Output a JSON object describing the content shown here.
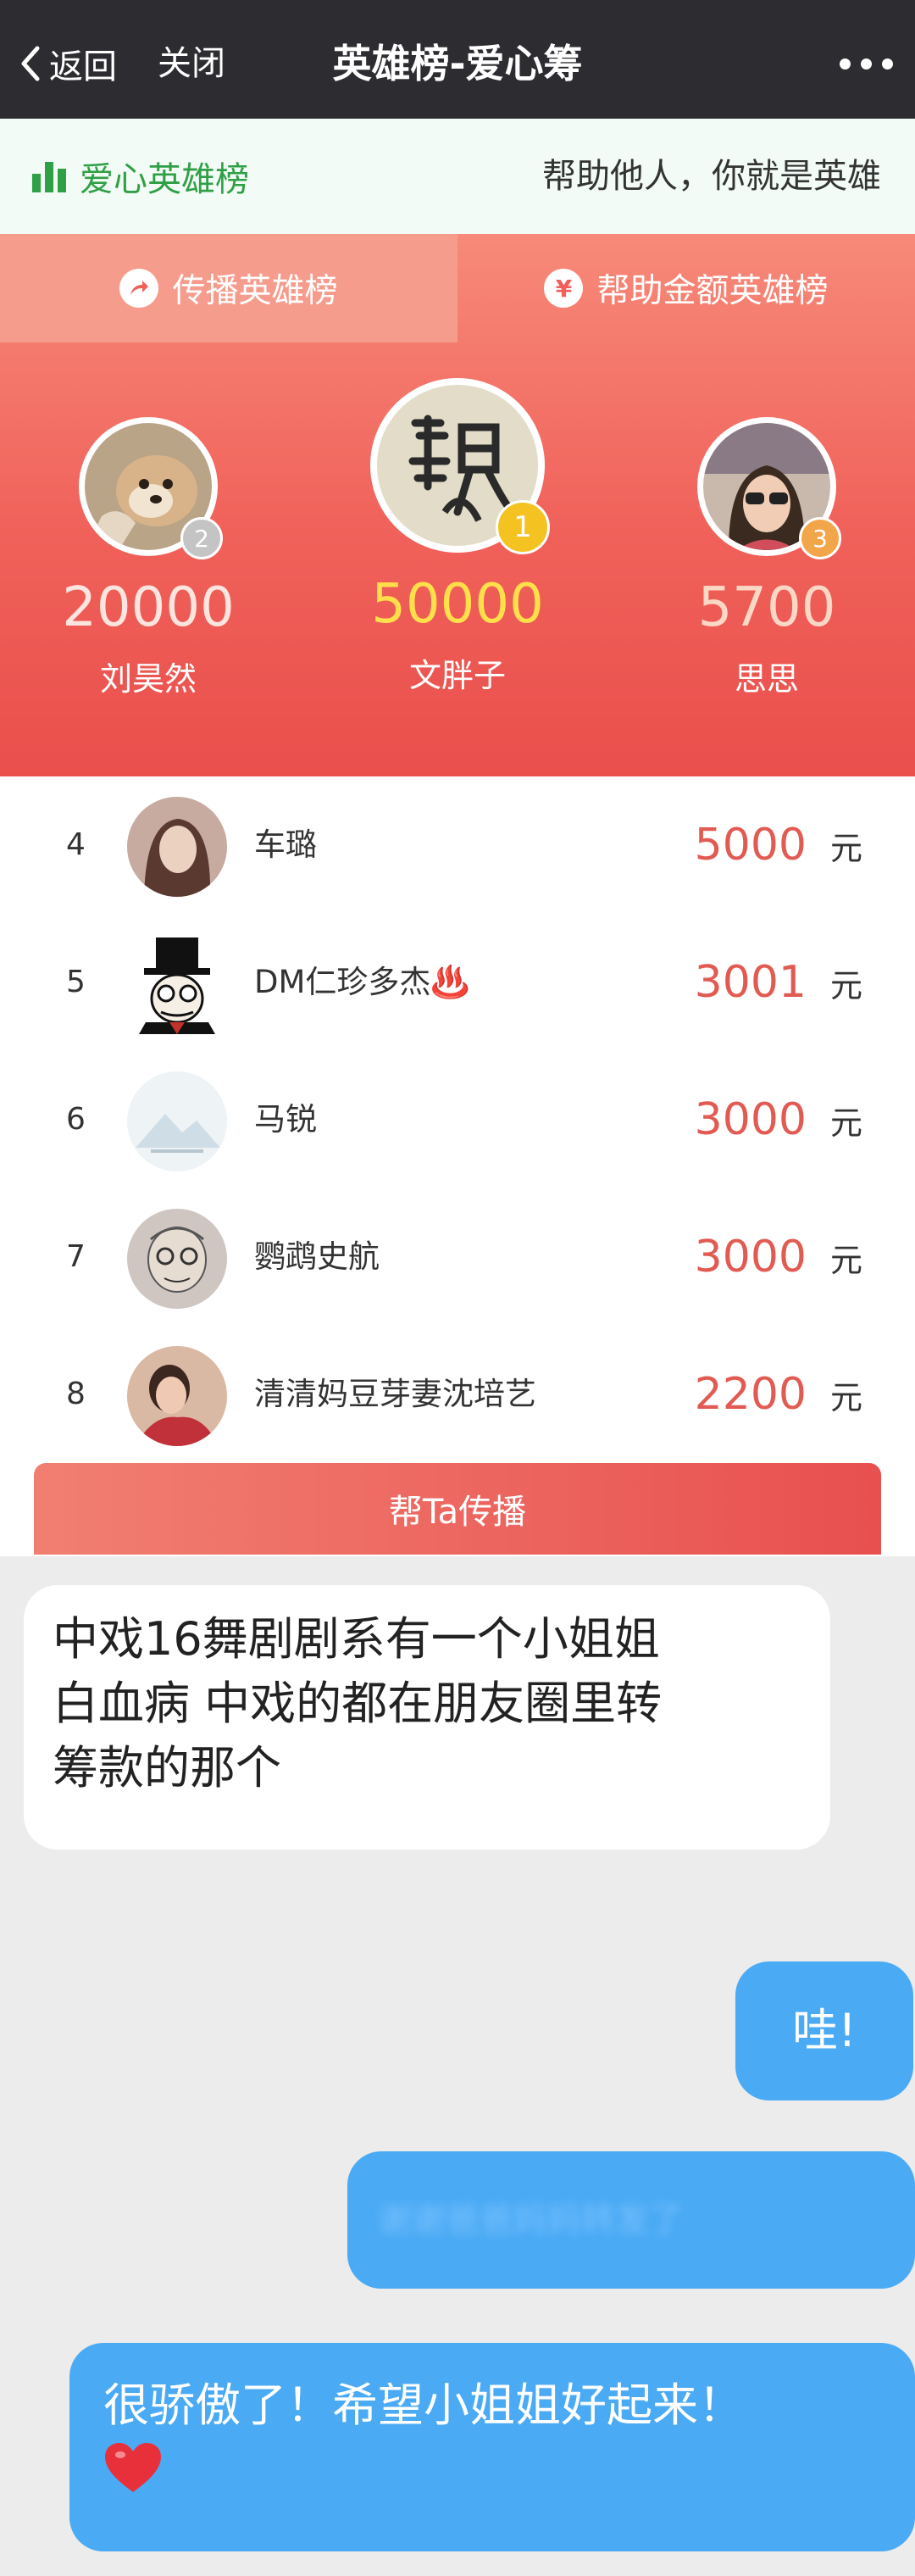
{
  "topbar": {
    "back_label": "返回",
    "close_label": "关闭",
    "title": "英雄榜-爱心筹"
  },
  "strip": {
    "brand": "爱心英雄榜",
    "slogan": "帮助他人，你就是英雄"
  },
  "tabs": [
    {
      "label": "传播英雄榜",
      "icon": "share-arrow-icon"
    },
    {
      "label": "帮助金额英雄榜",
      "icon": "yen-icon"
    }
  ],
  "podium": [
    {
      "rank": "2",
      "amount": "20000",
      "name": "刘昊然",
      "badge_color": "#c4c4c4",
      "amount_color": "#fce5de"
    },
    {
      "rank": "1",
      "amount": "50000",
      "name": "文胖子",
      "badge_color": "#f4c321",
      "amount_color": "#ffe04a"
    },
    {
      "rank": "3",
      "amount": "5700",
      "name": "思思",
      "badge_color": "#f3a54a",
      "amount_color": "#fbd8c6"
    }
  ],
  "list": [
    {
      "rank": "4",
      "name": "车璐",
      "amount": "5000",
      "unit": "元"
    },
    {
      "rank": "5",
      "name": "DM仁珍多杰♨️",
      "amount": "3001",
      "unit": "元"
    },
    {
      "rank": "6",
      "name": "马锐",
      "amount": "3000",
      "unit": "元"
    },
    {
      "rank": "7",
      "name": "鹦鹉史航",
      "amount": "3000",
      "unit": "元"
    },
    {
      "rank": "8",
      "name": "清清妈豆芽妻沈培艺",
      "amount": "2200",
      "unit": "元"
    }
  ],
  "share_button": "帮Ta传播",
  "chat": {
    "received": [
      "中戏16舞剧剧系有一个小姐姐",
      "白血病 中戏的都在朋友圈里转",
      "筹款的那个"
    ],
    "sent_1": "哇!",
    "sent_2_blurred": "谢谢爸爸妈妈转发了",
    "sent_3": "很骄傲了！希望小姐姐好起来！"
  }
}
